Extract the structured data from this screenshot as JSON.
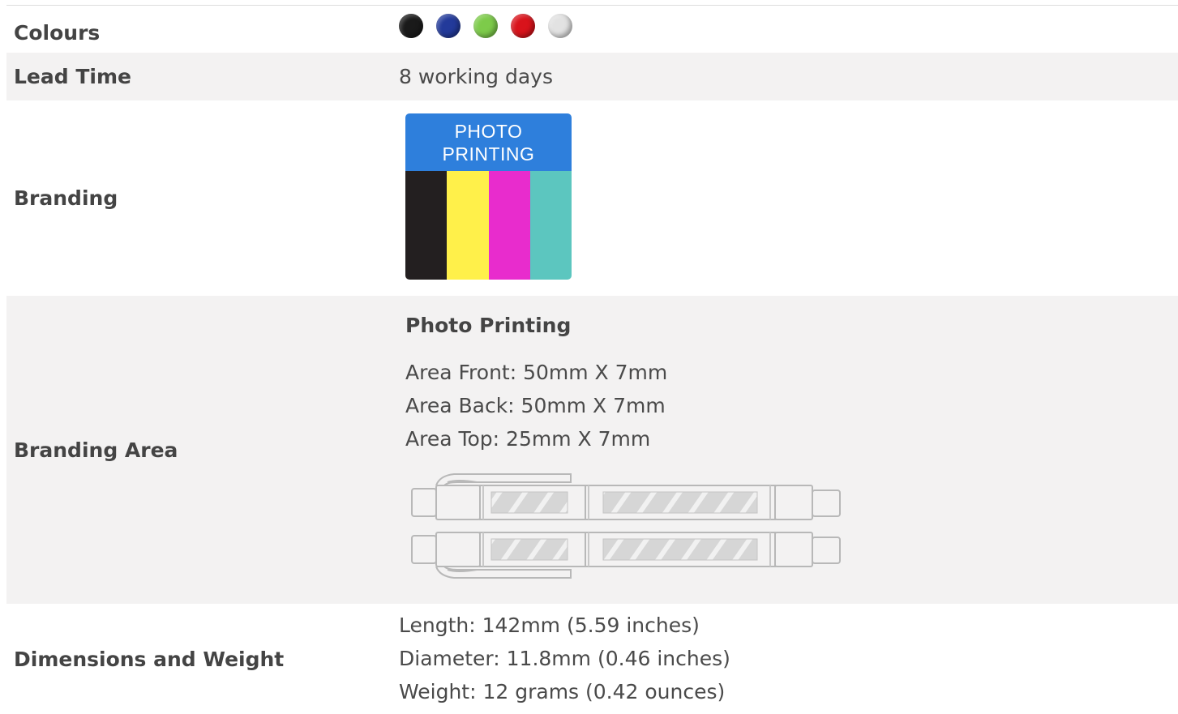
{
  "rows": {
    "colours": {
      "label": "Colours",
      "swatches": [
        {
          "name": "black",
          "color": "#1a1a1a"
        },
        {
          "name": "blue",
          "color": "#233a9a"
        },
        {
          "name": "green",
          "color": "#7dcb4a"
        },
        {
          "name": "red",
          "color": "#d9131b"
        },
        {
          "name": "white",
          "color": "#e2e2e2"
        }
      ]
    },
    "lead_time": {
      "label": "Lead Time",
      "value": "8 working days"
    },
    "branding": {
      "label": "Branding",
      "badge_line1": "PHOTO",
      "badge_line2": "PRINTING",
      "badge_colors": {
        "header": "#2e7fdc",
        "stripes": [
          "#231f20",
          "#fff04a",
          "#e82ccd",
          "#5cc6bf"
        ]
      }
    },
    "branding_area": {
      "label": "Branding Area",
      "title": "Photo Printing",
      "lines": [
        "Area Front: 50mm X 7mm",
        "Area Back: 50mm X 7mm",
        "Area Top: 25mm X 7mm"
      ]
    },
    "dimensions": {
      "label": "Dimensions and Weight",
      "lines": [
        "Length: 142mm (5.59 inches)",
        "Diameter: 11.8mm (0.46 inches)",
        "Weight: 12 grams (0.42 ounces)"
      ]
    }
  }
}
